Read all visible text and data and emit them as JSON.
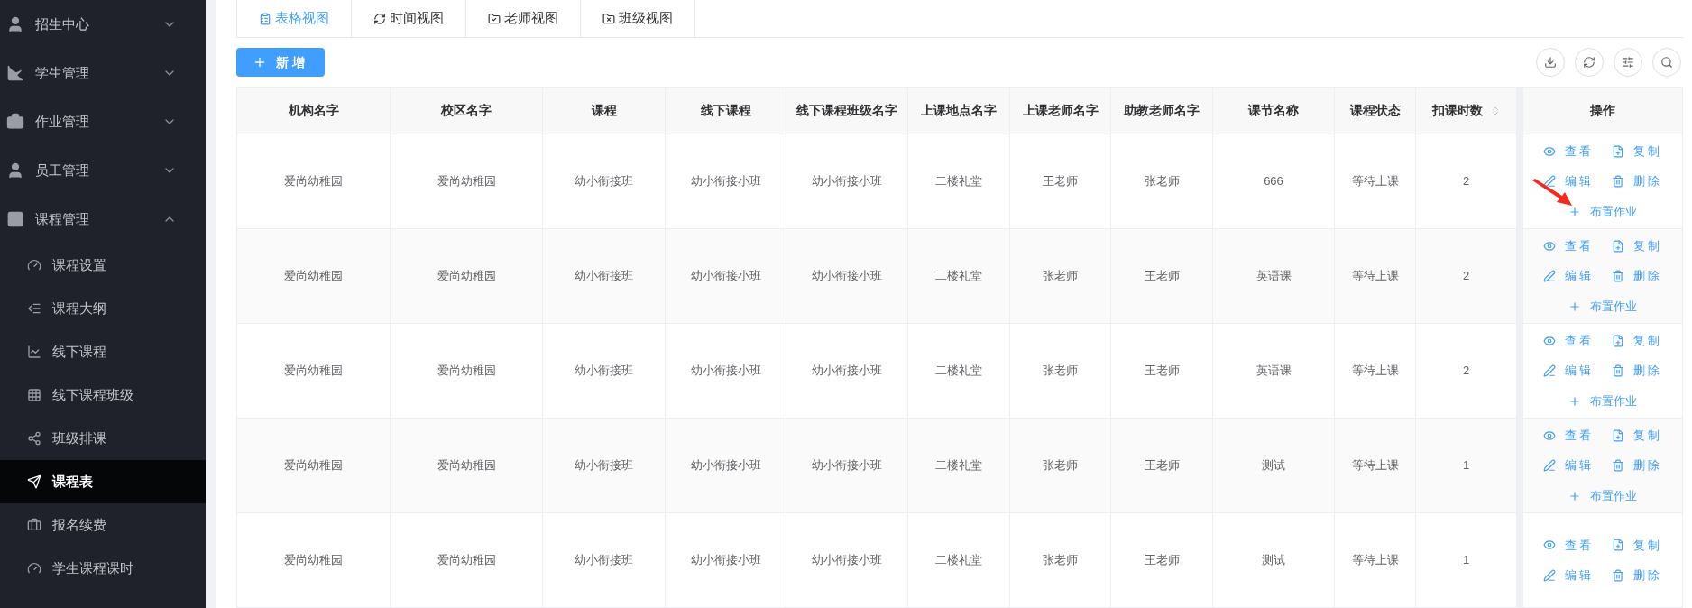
{
  "sidebar": {
    "items": [
      {
        "label": "招生中心",
        "expanded": false
      },
      {
        "label": "学生管理",
        "expanded": false
      },
      {
        "label": "作业管理",
        "expanded": false
      },
      {
        "label": "员工管理",
        "expanded": false
      },
      {
        "label": "课程管理",
        "expanded": true,
        "children": [
          {
            "label": "课程设置",
            "selected": false
          },
          {
            "label": "课程大纲",
            "selected": false
          },
          {
            "label": "线下课程",
            "selected": false
          },
          {
            "label": "线下课程班级",
            "selected": false
          },
          {
            "label": "班级排课",
            "selected": false
          },
          {
            "label": "课程表",
            "selected": true
          },
          {
            "label": "报名续费",
            "selected": false
          },
          {
            "label": "学生课程课时",
            "selected": false
          }
        ]
      }
    ]
  },
  "tabs": [
    {
      "label": "表格视图",
      "selected": true
    },
    {
      "label": "时间视图",
      "selected": false
    },
    {
      "label": "老师视图",
      "selected": false
    },
    {
      "label": "班级视图",
      "selected": false
    }
  ],
  "add_button": "新增",
  "table": {
    "columns": [
      {
        "label": "机构名字",
        "sortable": false
      },
      {
        "label": "校区名字",
        "sortable": false
      },
      {
        "label": "课程",
        "sortable": false
      },
      {
        "label": "线下课程",
        "sortable": false
      },
      {
        "label": "线下课程班级名字",
        "sortable": false
      },
      {
        "label": "上课地点名字",
        "sortable": false
      },
      {
        "label": "上课老师名字",
        "sortable": false
      },
      {
        "label": "助教老师名字",
        "sortable": false
      },
      {
        "label": "课节名称",
        "sortable": false
      },
      {
        "label": "课程状态",
        "sortable": false
      },
      {
        "label": "扣课时数",
        "sortable": true
      }
    ],
    "actions_column": "操作",
    "rows": [
      {
        "cells": [
          "爱尚幼稚园",
          "爱尚幼稚园",
          "幼小衔接班",
          "幼小衔接小班",
          "幼小衔接小班",
          "二楼礼堂",
          "王老师",
          "张老师",
          "666",
          "等待上课",
          "2"
        ],
        "actions": [
          {
            "kind": "view",
            "label": "查看"
          },
          {
            "kind": "copy",
            "label": "复制"
          },
          {
            "kind": "edit",
            "label": "编辑"
          },
          {
            "kind": "delete",
            "label": "删除"
          },
          {
            "kind": "assign",
            "label": "布置作业"
          }
        ]
      },
      {
        "cells": [
          "爱尚幼稚园",
          "爱尚幼稚园",
          "幼小衔接班",
          "幼小衔接小班",
          "幼小衔接小班",
          "二楼礼堂",
          "张老师",
          "王老师",
          "英语课",
          "等待上课",
          "2"
        ],
        "actions": [
          {
            "kind": "view",
            "label": "查看"
          },
          {
            "kind": "copy",
            "label": "复制"
          },
          {
            "kind": "edit",
            "label": "编辑"
          },
          {
            "kind": "delete",
            "label": "删除"
          },
          {
            "kind": "assign",
            "label": "布置作业"
          }
        ]
      },
      {
        "cells": [
          "爱尚幼稚园",
          "爱尚幼稚园",
          "幼小衔接班",
          "幼小衔接小班",
          "幼小衔接小班",
          "二楼礼堂",
          "张老师",
          "王老师",
          "英语课",
          "等待上课",
          "2"
        ],
        "actions": [
          {
            "kind": "view",
            "label": "查看"
          },
          {
            "kind": "copy",
            "label": "复制"
          },
          {
            "kind": "edit",
            "label": "编辑"
          },
          {
            "kind": "delete",
            "label": "删除"
          },
          {
            "kind": "assign",
            "label": "布置作业"
          }
        ]
      },
      {
        "cells": [
          "爱尚幼稚园",
          "爱尚幼稚园",
          "幼小衔接班",
          "幼小衔接小班",
          "幼小衔接小班",
          "二楼礼堂",
          "张老师",
          "王老师",
          "测试",
          "等待上课",
          "1"
        ],
        "actions": [
          {
            "kind": "view",
            "label": "查看"
          },
          {
            "kind": "copy",
            "label": "复制"
          },
          {
            "kind": "edit",
            "label": "编辑"
          },
          {
            "kind": "delete",
            "label": "删除"
          },
          {
            "kind": "assign",
            "label": "布置作业"
          }
        ]
      },
      {
        "cells": [
          "爱尚幼稚园",
          "爱尚幼稚园",
          "幼小衔接班",
          "幼小衔接小班",
          "幼小衔接小班",
          "二楼礼堂",
          "张老师",
          "王老师",
          "测试",
          "等待上课",
          "1"
        ],
        "actions": [
          {
            "kind": "view",
            "label": "查看"
          },
          {
            "kind": "copy",
            "label": "复制"
          },
          {
            "kind": "edit",
            "label": "编辑"
          },
          {
            "kind": "delete",
            "label": "删除"
          }
        ]
      }
    ]
  }
}
